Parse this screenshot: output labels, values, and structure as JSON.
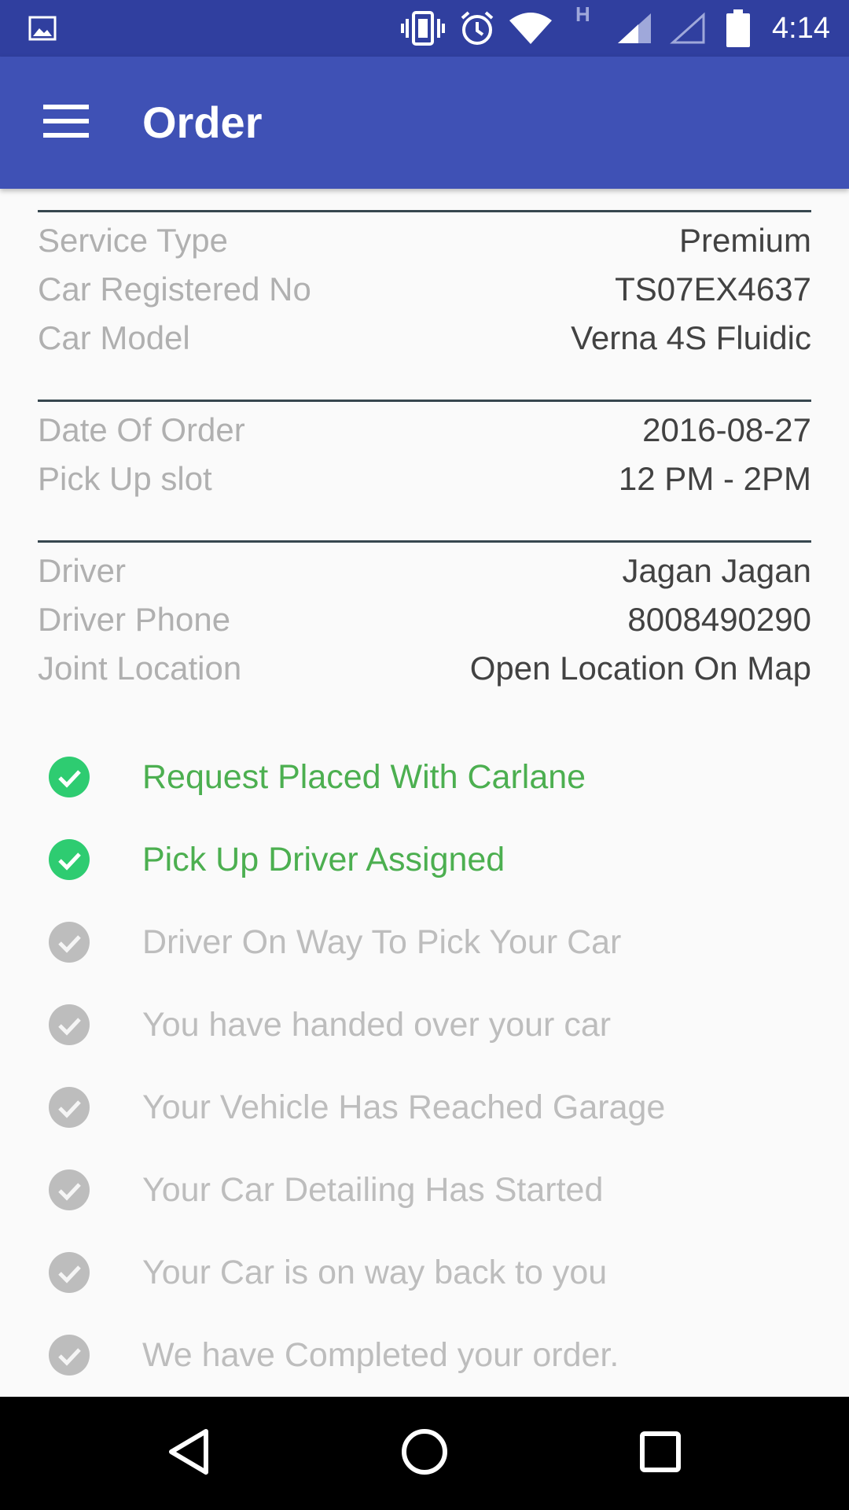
{
  "status_bar": {
    "time": "4:14",
    "icons": [
      "image-icon",
      "vibrate-icon",
      "alarm-icon",
      "wifi-icon",
      "network-h-icon",
      "signal-icon",
      "signal-empty-icon",
      "battery-icon"
    ],
    "network_type": "H"
  },
  "app_bar": {
    "title": "Order",
    "menu_icon": "hamburger-menu-icon"
  },
  "sections": [
    {
      "rows": [
        {
          "label": "Service Type",
          "value": "Premium"
        },
        {
          "label": "Car Registered No",
          "value": "TS07EX4637"
        },
        {
          "label": "Car Model",
          "value": "Verna 4S Fluidic"
        }
      ]
    },
    {
      "rows": [
        {
          "label": "Date Of Order",
          "value": "2016-08-27"
        },
        {
          "label": "Pick Up slot",
          "value": "12 PM - 2PM"
        }
      ]
    },
    {
      "rows": [
        {
          "label": "Driver",
          "value": "Jagan Jagan"
        },
        {
          "label": "Driver Phone",
          "value": "8008490290"
        },
        {
          "label": "Joint Location",
          "value": "Open Location On Map"
        }
      ]
    }
  ],
  "timeline": [
    {
      "label": "Request Placed With Carlane",
      "done": true
    },
    {
      "label": "Pick Up Driver Assigned",
      "done": true
    },
    {
      "label": "Driver On Way To Pick Your Car",
      "done": false
    },
    {
      "label": "You have handed over your car",
      "done": false
    },
    {
      "label": "Your Vehicle Has Reached Garage",
      "done": false
    },
    {
      "label": "Your Car Detailing Has Started",
      "done": false
    },
    {
      "label": "Your Car is on way back to you",
      "done": false
    },
    {
      "label": "We have Completed your order.",
      "done": false
    }
  ],
  "colors": {
    "primary": "#3f51b5",
    "primary_dark": "#303f9f",
    "done_text": "#4caf50",
    "done_icon": "#2ecc71",
    "pending": "#bdbdbd",
    "label": "#b0b0b0",
    "value": "#424242"
  },
  "nav_bar": {
    "icons": [
      "back-icon",
      "home-icon",
      "recents-icon"
    ]
  }
}
